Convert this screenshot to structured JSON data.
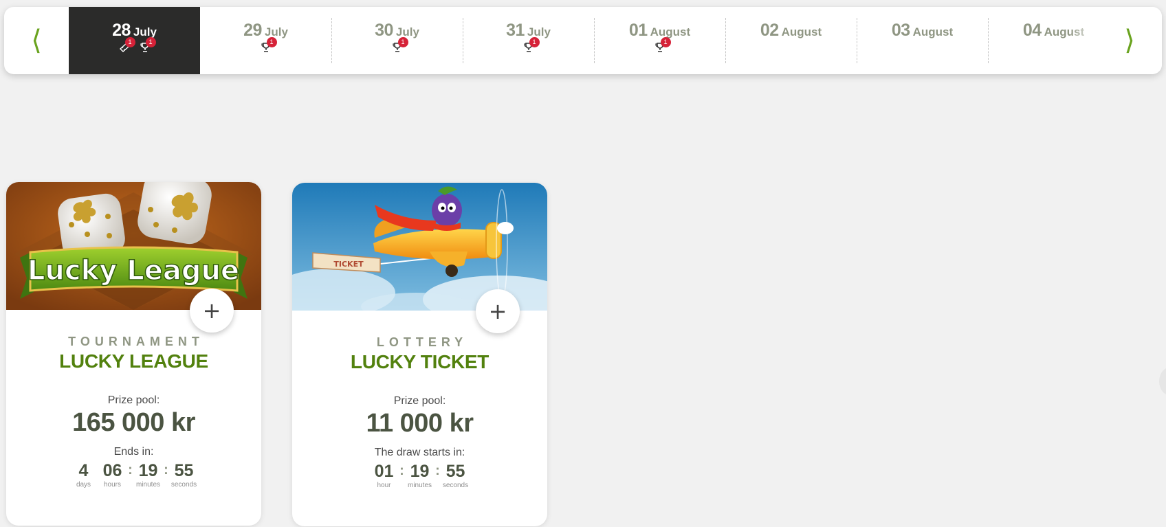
{
  "nav": {
    "prev_icon": "chevron-left-icon",
    "next_icon": "chevron-right-icon"
  },
  "days": [
    {
      "num": "28",
      "month": "July",
      "active": true,
      "events": [
        {
          "icon": "ticket-icon",
          "count": "1"
        },
        {
          "icon": "trophy-icon",
          "count": "1"
        }
      ]
    },
    {
      "num": "29",
      "month": "July",
      "events": [
        {
          "icon": "trophy-icon",
          "count": "1"
        }
      ]
    },
    {
      "num": "30",
      "month": "July",
      "events": [
        {
          "icon": "trophy-icon",
          "count": "1"
        }
      ]
    },
    {
      "num": "31",
      "month": "July",
      "events": [
        {
          "icon": "trophy-icon",
          "count": "1"
        }
      ]
    },
    {
      "num": "01",
      "month": "August",
      "events": [
        {
          "icon": "trophy-icon",
          "count": "1"
        }
      ]
    },
    {
      "num": "02",
      "month": "August",
      "events": []
    },
    {
      "num": "03",
      "month": "August",
      "events": []
    },
    {
      "num": "04",
      "month": "August",
      "events": []
    }
  ],
  "cards": [
    {
      "image_text": "Lucky League",
      "kind": "TOURNAMENT",
      "name": "LUCKY LEAGUE",
      "pool_label": "Prize pool:",
      "pool_value": "165 000 kr",
      "timer_label": "Ends in:",
      "timer": [
        {
          "value": "4",
          "label": "days"
        },
        {
          "value": "06",
          "label": "hours"
        },
        {
          "value": "19",
          "label": "minutes"
        },
        {
          "value": "55",
          "label": "seconds"
        }
      ],
      "add_label": "+"
    },
    {
      "image_text": "TICKET",
      "kind": "LOTTERY",
      "name": "LUCKY TICKET",
      "pool_label": "Prize pool:",
      "pool_value": "11 000 kr",
      "timer_label": "The draw starts in:",
      "timer": [
        {
          "value": "01",
          "label": "hour"
        },
        {
          "value": "19",
          "label": "minutes"
        },
        {
          "value": "55",
          "label": "seconds"
        }
      ],
      "add_label": "+"
    }
  ],
  "colors": {
    "accent_green": "#52810e",
    "arrow_green": "#6aa31f",
    "badge_red": "#d62238",
    "active_day_bg": "#2b2b2a",
    "page_bg": "#f1f1f1"
  }
}
